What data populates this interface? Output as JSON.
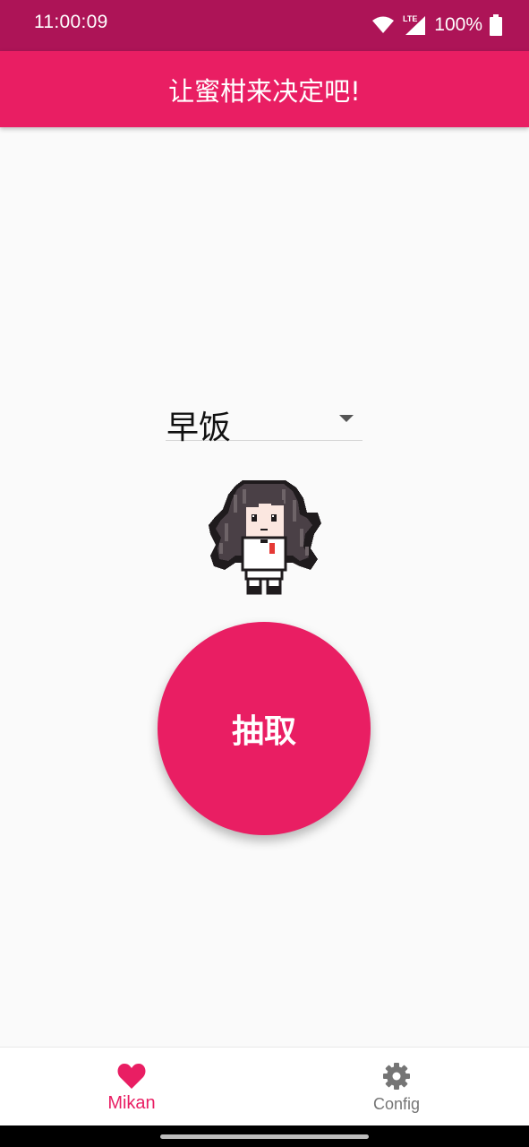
{
  "status_bar": {
    "time": "11:00:09",
    "battery": "100%",
    "network": "LTE",
    "icons": [
      "wifi-icon",
      "signal-icon",
      "battery-icon"
    ]
  },
  "app_bar": {
    "title": "让蜜柑来决定吧!"
  },
  "main": {
    "dropdown_value": "早饭",
    "draw_button_label": "抽取",
    "mascot": "pixel-character-image"
  },
  "bottom_nav": {
    "items": [
      {
        "label": "Mikan",
        "icon": "heart-icon",
        "active": true
      },
      {
        "label": "Config",
        "icon": "gear-icon",
        "active": false
      }
    ]
  },
  "colors": {
    "primary": "#e91e63",
    "status_bar": "#ad1457",
    "inactive": "#757575",
    "background": "#fafafa"
  }
}
